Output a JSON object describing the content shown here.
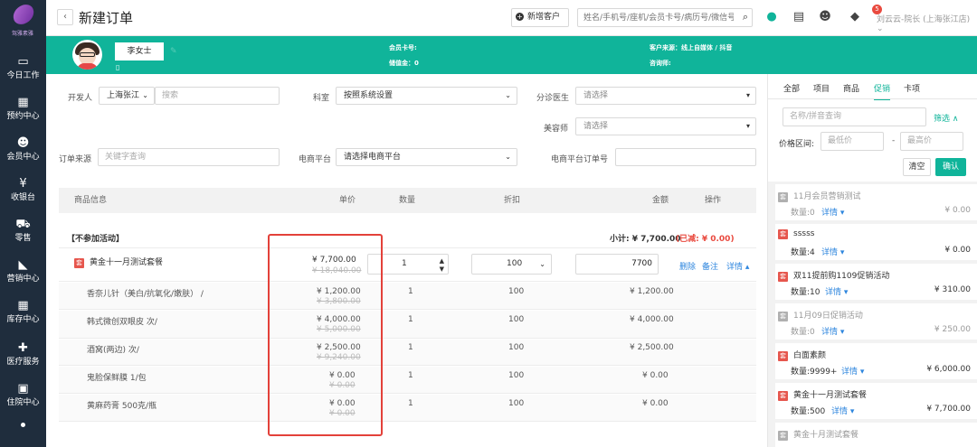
{
  "brand": {
    "logo_text": "驾雅素雅"
  },
  "sidebar": {
    "items": [
      {
        "label": "今日工作",
        "icon": "laptop-icon",
        "glyph": "▭"
      },
      {
        "label": "预约中心",
        "icon": "calendar-icon",
        "glyph": "▦"
      },
      {
        "label": "会员中心",
        "icon": "users-icon",
        "glyph": "☻"
      },
      {
        "label": "收银台",
        "icon": "yen-icon",
        "glyph": "¥"
      },
      {
        "label": "零售",
        "icon": "cart-icon",
        "glyph": "⛟"
      },
      {
        "label": "营销中心",
        "icon": "megaphone-icon",
        "glyph": "◣"
      },
      {
        "label": "库存中心",
        "icon": "grid-icon",
        "glyph": "▦"
      },
      {
        "label": "医疗服务",
        "icon": "medkit-icon",
        "glyph": "✚"
      },
      {
        "label": "住院中心",
        "icon": "building-icon",
        "glyph": "▣"
      }
    ]
  },
  "header": {
    "back": "‹",
    "title": "新建订单",
    "new_customer": "新增客户",
    "search_placeholder": "姓名/手机号/座机/会员卡号/病历号/微信号",
    "bell_count": "5",
    "user": "刘云云-院长 (上海张江店)"
  },
  "customer": {
    "name": "李女士",
    "card_label": "会员卡号:",
    "balance": "储值金：0",
    "source": "客户来源：线上自媒体 / 抖音",
    "consultant": "咨询师:"
  },
  "form": {
    "developer_label": "开发人",
    "developer_value": "上海张江",
    "developer_placeholder": "搜索",
    "dept_label": "科室",
    "dept_value": "按照系统设置",
    "triage_label": "分诊医生",
    "triage_value": "请选择",
    "beautician_label": "美容师",
    "beautician_value": "请选择",
    "source_label": "订单来源",
    "source_placeholder": "关键字查询",
    "ecom_label": "电商平台",
    "ecom_value": "请选择电商平台",
    "ecom_order_label": "电商平台订单号"
  },
  "table": {
    "headers": [
      "商品信息",
      "单价",
      "数量",
      "折扣",
      "金额",
      "操作"
    ],
    "group_label": "【不参加活动】",
    "subtotal": "小计: ¥ 7,700.00",
    "reduced": "(已减: ¥ 0.00)",
    "main": {
      "name": "黄金十一月测试套餐",
      "price": "¥ 7,700.00",
      "orig": "¥ 18,040.00",
      "qty": "1",
      "discount": "100",
      "amount": "7700",
      "ops": [
        "删除",
        "备注",
        "详情"
      ]
    },
    "items": [
      {
        "name": "香奈儿针（美白/抗氧化/嫩肤） /",
        "price": "¥ 1,200.00",
        "orig": "¥ 3,800.00",
        "qty": "1",
        "discount": "100",
        "amount": "¥ 1,200.00"
      },
      {
        "name": "韩式微创双眼皮 次/",
        "price": "¥ 4,000.00",
        "orig": "¥ 5,000.00",
        "qty": "1",
        "discount": "100",
        "amount": "¥ 4,000.00"
      },
      {
        "name": "酒窝(两边) 次/",
        "price": "¥ 2,500.00",
        "orig": "¥ 9,240.00",
        "qty": "1",
        "discount": "100",
        "amount": "¥ 2,500.00"
      },
      {
        "name": "鬼脸保鲜膜 1/包",
        "price": "¥ 0.00",
        "orig": "¥ 0.00",
        "qty": "1",
        "discount": "100",
        "amount": "¥ 0.00"
      },
      {
        "name": "黄麻药膏 500克/瓶",
        "price": "¥ 0.00",
        "orig": "¥ 0.00",
        "qty": "1",
        "discount": "100",
        "amount": "¥ 0.00"
      }
    ]
  },
  "panel": {
    "tabs": [
      "全部",
      "项目",
      "商品",
      "促销",
      "卡项"
    ],
    "search_placeholder": "名称/拼音查询",
    "filter": "筛选 ∧",
    "price_label": "价格区间:",
    "min_placeholder": "最低价",
    "max_placeholder": "最高价",
    "clear": "清空",
    "confirm": "确认",
    "promos": [
      {
        "name": "11月会员营销测试",
        "qty": "数量:0",
        "detail": "详情",
        "price": "¥ 0.00",
        "active": false
      },
      {
        "name": "sssss",
        "qty": "数量:4",
        "detail": "详情",
        "price": "¥ 0.00",
        "active": true
      },
      {
        "name": "双11提前购1109促销活动",
        "qty": "数量:10",
        "detail": "详情",
        "price": "¥ 310.00",
        "active": true
      },
      {
        "name": "11月09日促销活动",
        "qty": "数量:0",
        "detail": "详情",
        "price": "¥ 250.00",
        "active": false
      },
      {
        "name": "白面素颜",
        "qty": "数量:9999+",
        "detail": "详情",
        "price": "¥ 6,000.00",
        "active": true
      },
      {
        "name": "黄金十一月测试套餐",
        "qty": "数量:500",
        "detail": "详情",
        "price": "¥ 7,700.00",
        "active": true
      },
      {
        "name": "黄金十月测试套餐",
        "qty": "",
        "detail": "",
        "price": "",
        "active": false
      }
    ]
  },
  "colors": {
    "brand_green": "#10b49a",
    "link_blue": "#2e86de",
    "highlight_red": "#e3413a"
  }
}
